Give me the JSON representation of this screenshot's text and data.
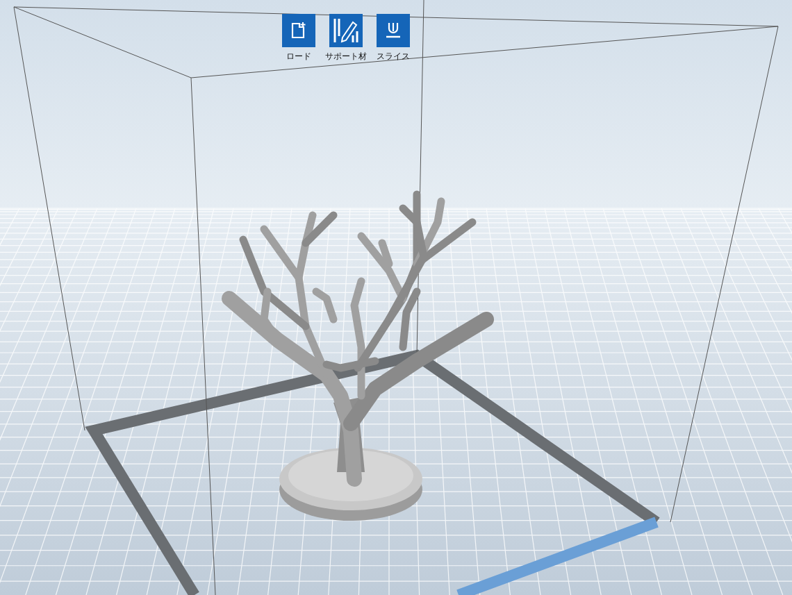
{
  "toolbar": [
    {
      "kind": "load",
      "label": "ロード"
    },
    {
      "kind": "support",
      "label": "サポート材"
    },
    {
      "kind": "slice",
      "label": "スライス"
    }
  ]
}
